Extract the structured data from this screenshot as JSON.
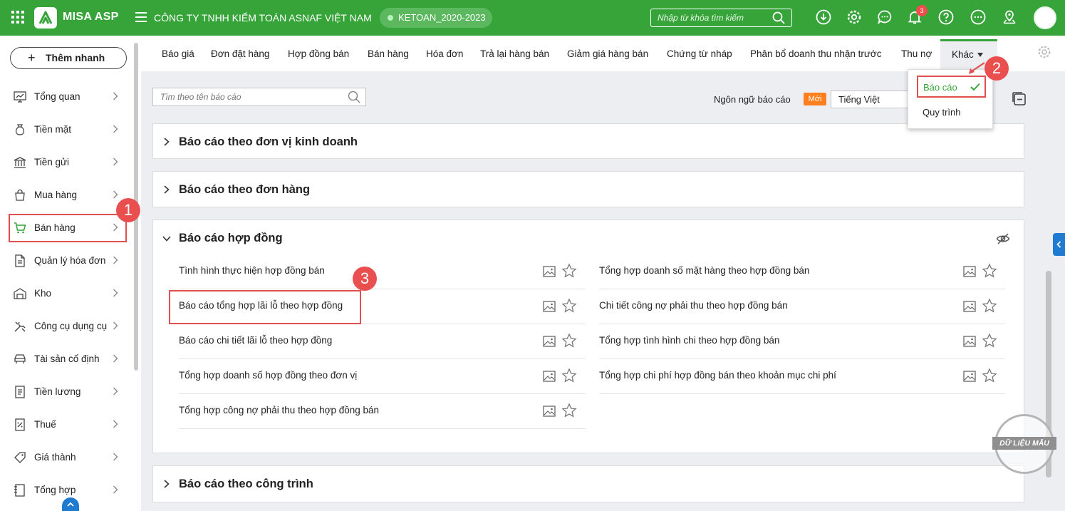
{
  "header": {
    "app_name": "MISA ASP",
    "company": "CÔNG TY TNHH KIỂM TOÁN ASNAF VIỆT NAM",
    "database": "KETOAN_2020-2023",
    "search_placeholder": "Nhập từ khóa tìm kiếm",
    "notification_count": "3",
    "colors": {
      "primary": "#37a43a",
      "badge": "#ee4d4d"
    }
  },
  "sidebar": {
    "quick_add_label": "Thêm nhanh",
    "items": [
      {
        "label": "Tổng quan",
        "icon": "dashboard-icon"
      },
      {
        "label": "Tiền mặt",
        "icon": "money-bag-icon"
      },
      {
        "label": "Tiền gửi",
        "icon": "bank-icon"
      },
      {
        "label": "Mua hàng",
        "icon": "shopping-bag-icon"
      },
      {
        "label": "Bán hàng",
        "icon": "cart-icon",
        "active": true
      },
      {
        "label": "Quản lý hóa đơn",
        "icon": "invoice-icon"
      },
      {
        "label": "Kho",
        "icon": "warehouse-icon"
      },
      {
        "label": "Công cụ dụng cụ",
        "icon": "tools-icon"
      },
      {
        "label": "Tài sản cố định",
        "icon": "car-icon"
      },
      {
        "label": "Tiền lương",
        "icon": "payroll-icon"
      },
      {
        "label": "Thuế",
        "icon": "tax-icon"
      },
      {
        "label": "Giá thành",
        "icon": "price-tag-icon"
      },
      {
        "label": "Tổng hợp",
        "icon": "ledger-icon"
      }
    ]
  },
  "tabs": [
    "Báo giá",
    "Đơn đặt hàng",
    "Hợp đồng bán",
    "Bán hàng",
    "Hóa đơn",
    "Trả lại hàng bán",
    "Giảm giá hàng bán",
    "Chứng từ nháp",
    "Phân bổ doanh thu nhận trước",
    "Thu nợ"
  ],
  "other_tab": {
    "label": "Khác",
    "menu": [
      {
        "label": "Báo cáo",
        "selected": true
      },
      {
        "label": "Quy trình"
      }
    ]
  },
  "toolbar": {
    "report_search_placeholder": "Tìm theo tên báo cáo",
    "language_label": "Ngôn ngữ báo cáo",
    "new_badge": "Mới",
    "language_value": "Tiếng Việt"
  },
  "sections": [
    {
      "title": "Báo cáo theo đơn vị kinh doanh",
      "expanded": false
    },
    {
      "title": "Báo cáo theo đơn hàng",
      "expanded": false
    },
    {
      "title": "Báo cáo hợp đồng",
      "expanded": true,
      "left_reports": [
        "Tình hình thực hiện hợp đồng bán",
        "Báo cáo tổng hợp lãi lỗ theo hợp đồng",
        "Báo cáo chi tiết lãi lỗ theo hợp đồng",
        "Tổng hợp doanh số hợp đồng theo đơn vị",
        "Tổng hợp công nợ phải thu theo hợp đồng bán"
      ],
      "right_reports": [
        "Tổng hợp doanh số mặt hàng theo hợp đồng bán",
        "Chi tiết công nợ phải thu theo hợp đồng bán",
        "Tổng hợp tình hình chi theo hợp đồng bán",
        "Tổng hợp chi phí hợp đồng bán theo khoản mục chi phí"
      ]
    },
    {
      "title": "Báo cáo theo công trình",
      "expanded": false
    }
  ],
  "callouts": [
    "1",
    "2",
    "3"
  ],
  "stamp_text": "DỮ LIỆU MẪU"
}
